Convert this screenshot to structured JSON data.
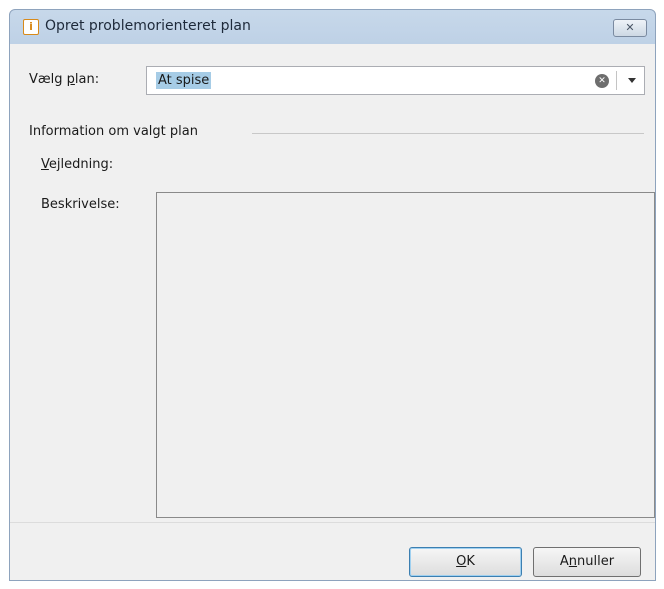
{
  "window": {
    "title": "Opret problemorienteret plan",
    "close_label": "✕"
  },
  "form": {
    "plan_label_pre": "Vælg ",
    "plan_label_acc": "p",
    "plan_label_post": "lan:",
    "plan_value": "At spise",
    "group_title": "Information om valgt plan",
    "guide_label_acc": "V",
    "guide_label_post": "ejledning:",
    "description_label": "Beskrivelse:",
    "description_value": ""
  },
  "buttons": {
    "ok_acc": "O",
    "ok_post": "K",
    "cancel_pre": "A",
    "cancel_acc": "n",
    "cancel_post": "nuller"
  },
  "icons": {
    "app": "document-icon",
    "clear": "clear-icon",
    "dropdown": "chevron-down-icon"
  },
  "colors": {
    "selection": "#a6cce6",
    "titlebar": "#c7d8ea",
    "default_button_border": "#3c7fb1"
  }
}
